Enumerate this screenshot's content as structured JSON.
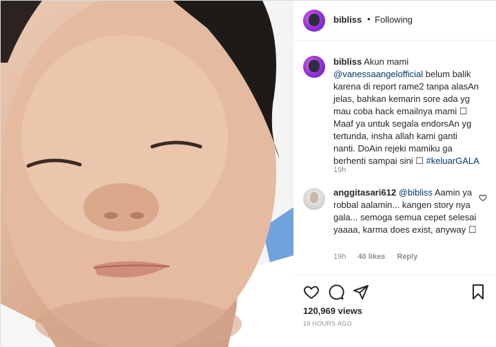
{
  "post": {
    "username": "bibliss",
    "separator": "•",
    "follow_status": "Following"
  },
  "caption": {
    "username": "bibliss",
    "text_1": "Akun mami",
    "mention": "@vanessaangelofficial",
    "text_2": "belum balik karena di report rame2 tanpa alasAn jelas, bahkan kemarin sore ada yg mau coba hack emailnya mami ☐ Maaf ya untuk segala endorsAn yg tertunda, insha allah kami ganti nanti. DoAin rejeki mamiku ga berhenti sampai sini ☐",
    "hashtag": "#keluarGALA",
    "time": "19h"
  },
  "comment": {
    "username": "anggitasari612",
    "mention": "@bibliss",
    "text": "Aamin ya robbal aalamin... kangen story nya gala... semoga semua cepet selesai yaaaa, karma does exist, anyway ☐",
    "time": "19h",
    "likes": "40 likes",
    "reply": "Reply"
  },
  "stats": {
    "views": "120,969 views",
    "posted": "19 HOURS AGO"
  },
  "icons": [
    "heart-icon",
    "comment-icon",
    "share-icon",
    "bookmark-icon",
    "heart-small-icon"
  ]
}
